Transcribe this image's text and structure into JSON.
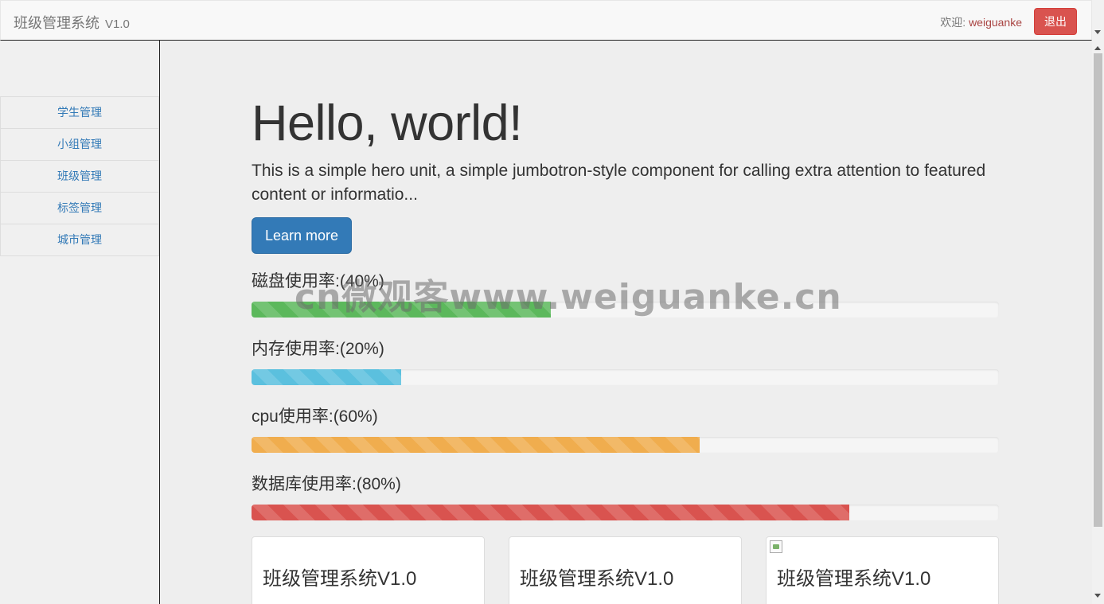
{
  "navbar": {
    "brand": "班级管理系统",
    "version": "V1.0",
    "welcome_prefix": "欢迎: ",
    "username": "weiguanke",
    "logout_label": "退出"
  },
  "sidebar": {
    "items": [
      {
        "label": "学生管理"
      },
      {
        "label": "小组管理"
      },
      {
        "label": "班级管理"
      },
      {
        "label": "标签管理"
      },
      {
        "label": "城市管理"
      }
    ]
  },
  "hero": {
    "title": "Hello, world!",
    "text": "This is a simple hero unit, a simple jumbotron-style component for calling extra attention to featured content or informatio...",
    "button_label": "Learn more"
  },
  "stats": [
    {
      "label": "磁盘使用率:(40%)",
      "percent": 40,
      "color": "#5cb85c"
    },
    {
      "label": "内存使用率:(20%)",
      "percent": 20,
      "color": "#5bc0de"
    },
    {
      "label": "cpu使用率:(60%)",
      "percent": 60,
      "color": "#f0ad4e"
    },
    {
      "label": "数据库使用率:(80%)",
      "percent": 80,
      "color": "#d9534f"
    }
  ],
  "cards": [
    {
      "title": "班级管理系统V1.0",
      "broken_image": false
    },
    {
      "title": "班级管理系统V1.0",
      "broken_image": false
    },
    {
      "title": "班级管理系统V1.0",
      "broken_image": true
    }
  ],
  "watermark": "cn微观客www.weiguanke.cn"
}
